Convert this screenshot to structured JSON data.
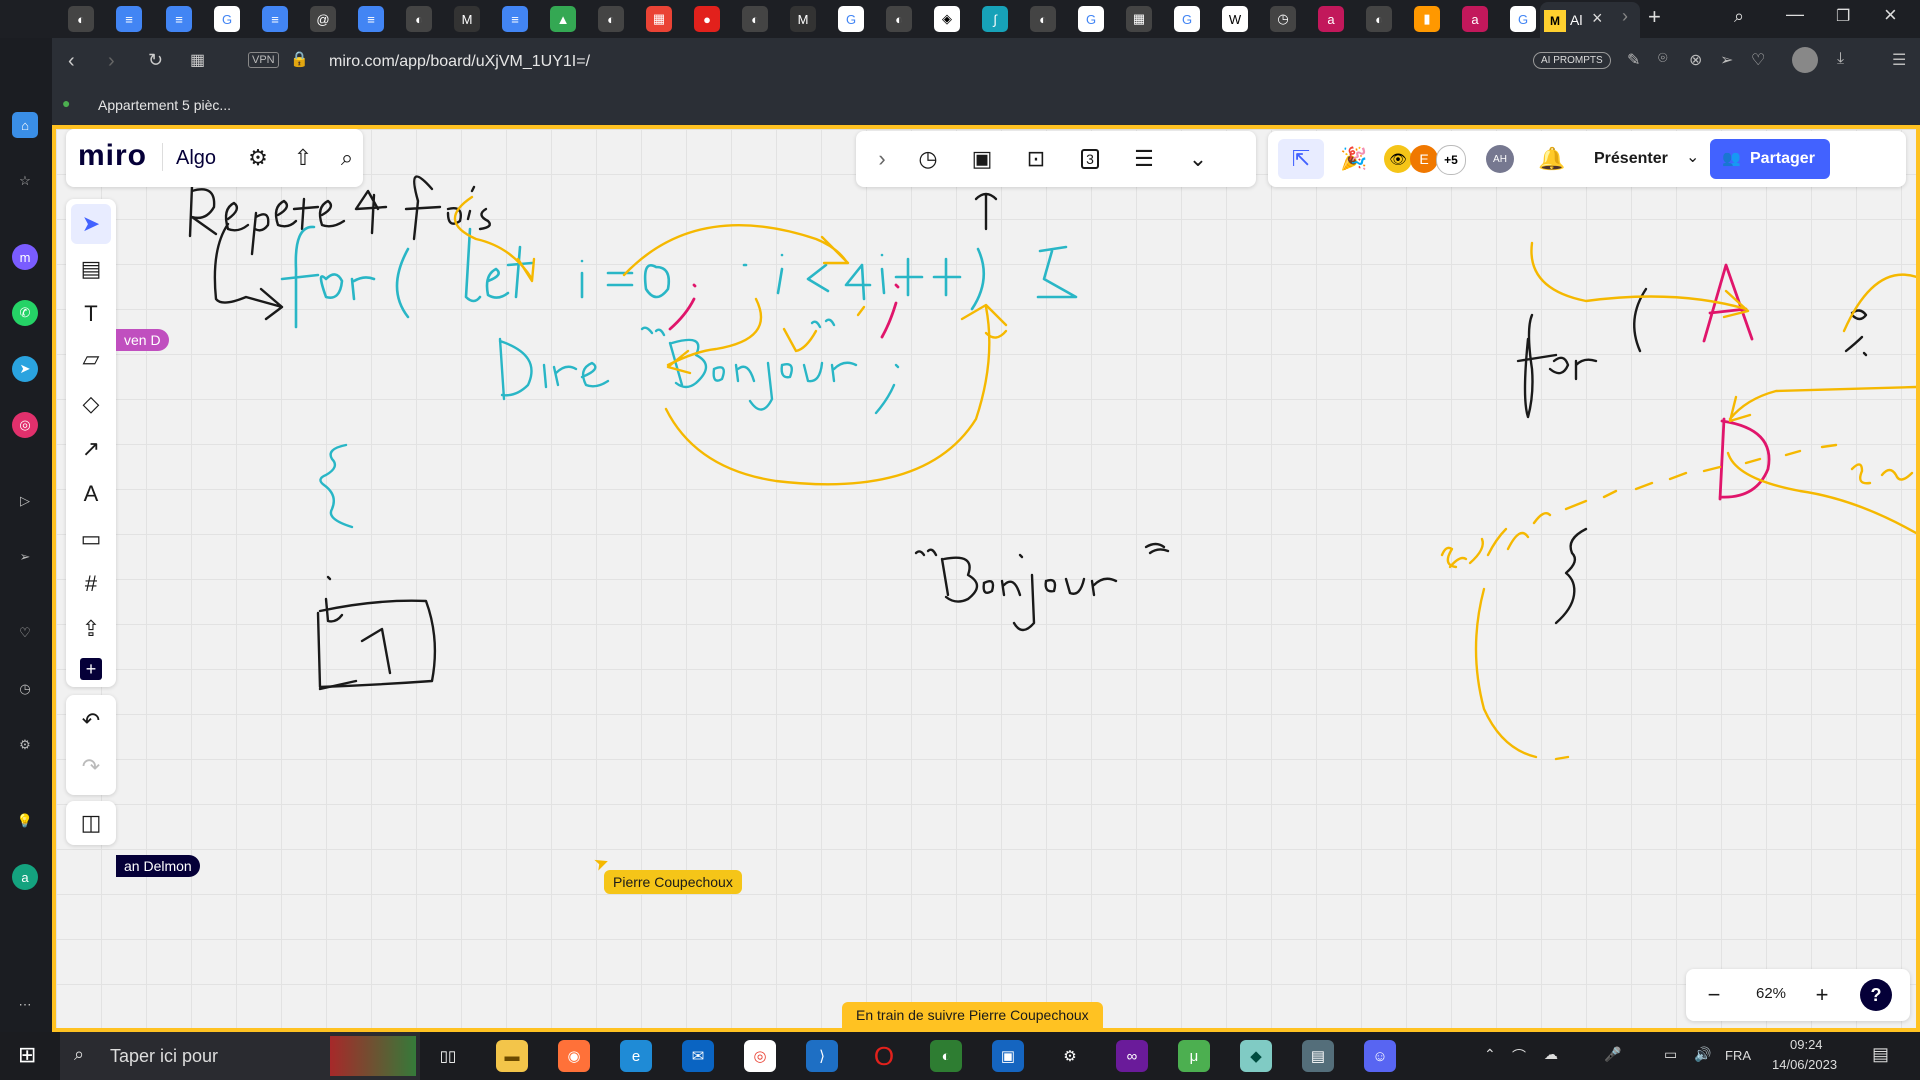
{
  "browser": {
    "url": "miro.com/app/board/uXjVM_1UY1I=/",
    "vpn_label": "VPN",
    "ai_prompts_label": "AI PROMPTS",
    "bookmark": "Appartement 5 pièc...",
    "active_tab_label": "Al"
  },
  "miro": {
    "logo": "miro",
    "board_name": "Algo",
    "present_label": "Présenter",
    "share_label": "Partager",
    "avatar_e": "E",
    "avatar_more": "+5",
    "avatar_ah": "AH",
    "panel_badge": "3",
    "zoom": "62%",
    "help": "?"
  },
  "board": {
    "cursor_label": "Pierre Coupechoux",
    "tag_left": "ven D",
    "tag_bottom": "an Delmon",
    "follow_banner": "En train de suivre Pierre Coupechoux"
  },
  "taskbar": {
    "search_placeholder": "Taper ici pour",
    "language": "FRA",
    "time": "09:24",
    "date": "14/06/2023"
  },
  "colors": {
    "accent": "#ffc222",
    "share_blue": "#4262ff",
    "cyan_ink": "#29b6c6",
    "yellow_ink": "#f5b800",
    "pink_ink": "#e0156b"
  }
}
